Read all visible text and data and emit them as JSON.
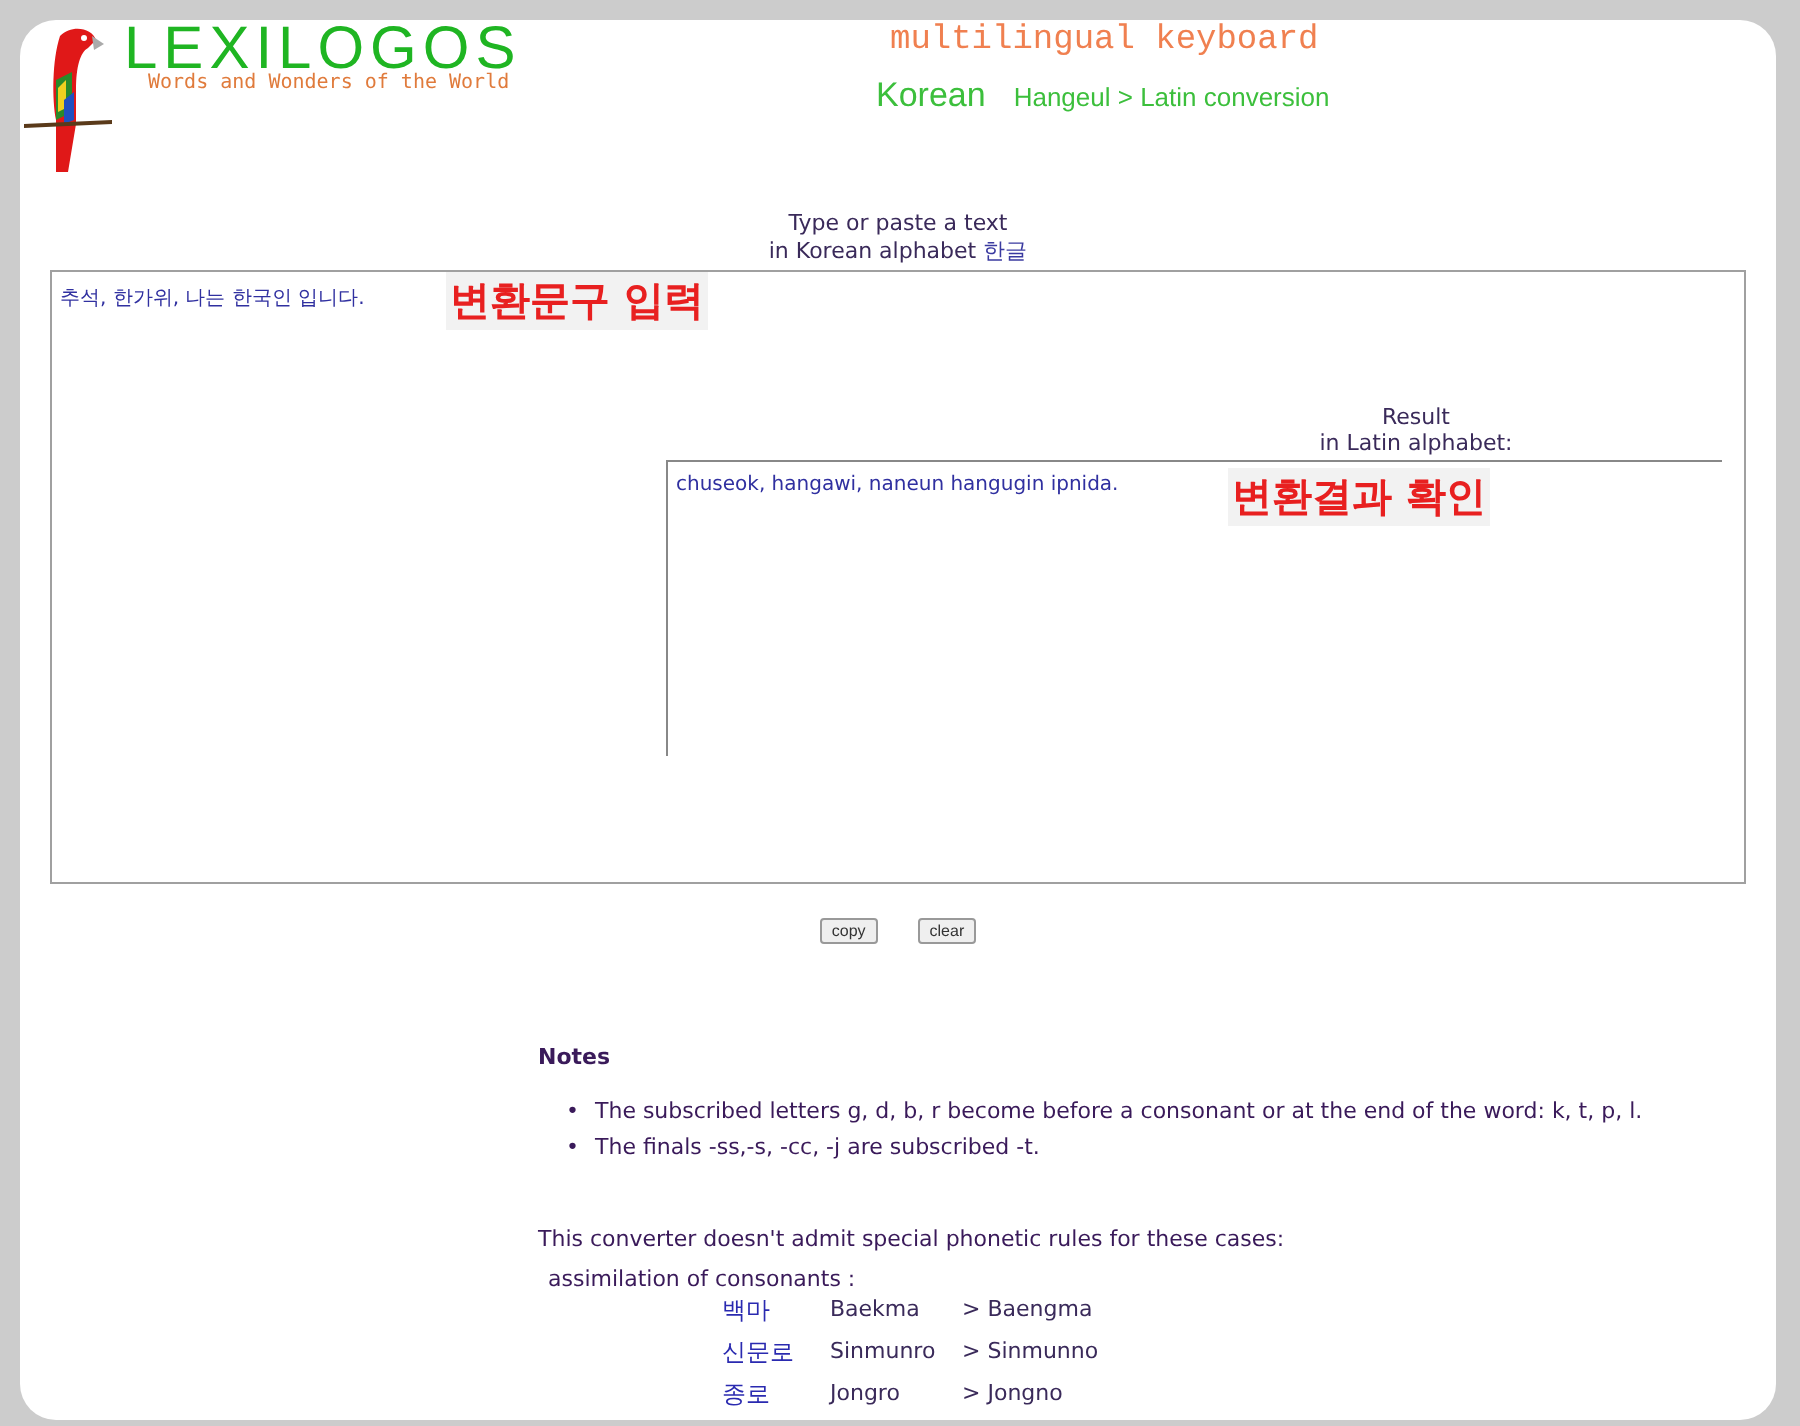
{
  "header": {
    "logo": "LEXILOGOS",
    "tagline": "Words and Wonders of the World",
    "section": "multilingual keyboard",
    "language": "Korean",
    "subtitle": "Hangeul > Latin conversion"
  },
  "input": {
    "label_line1": "Type or paste a text",
    "label_line2": "in Korean alphabet",
    "label_script": "한글",
    "value": "추석, 한가위, 나는 한국인 입니다.",
    "annotation": "변환문구 입력"
  },
  "result": {
    "label_line1": "Result",
    "label_line2": "in Latin alphabet:",
    "value": "chuseok, hangawi, naneun hangugin ipnida.",
    "annotation": "변환결과 확인"
  },
  "buttons": [
    "copy",
    "clear"
  ],
  "notes": {
    "title": "Notes",
    "items": [
      {
        "marker": "•",
        "text": "The subscribed letters g, d, b, r become before a consonant or at the end of the word: k, t, p, l."
      },
      {
        "marker": "•",
        "text": "The finals -ss,-s, -cc, -j are subscribed -t."
      }
    ]
  },
  "exceptions": {
    "intro": "This converter doesn't admit special phonetic rules for these cases:",
    "heading": "assimilation of consonants :",
    "rows": [
      {
        "hangeul": "백마",
        "written": "Baekma",
        "spoken": "> Baengma"
      },
      {
        "hangeul": "신문로",
        "written": "Sinmunro",
        "spoken": "> Sinmunno"
      },
      {
        "hangeul": "종로",
        "written": "Jongro",
        "spoken": "> Jongno"
      }
    ]
  }
}
